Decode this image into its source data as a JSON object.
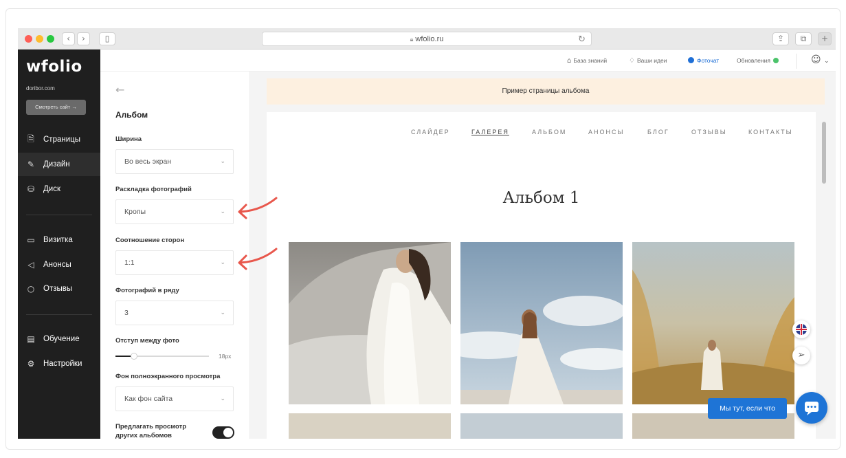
{
  "browser": {
    "url": "wfolio.ru"
  },
  "sidebar": {
    "logo": "wfolio",
    "site": "doribor.com",
    "view_site": "Смотреть сайт →",
    "items": [
      {
        "label": "Страницы",
        "icon": "page-icon"
      },
      {
        "label": "Дизайн",
        "icon": "brush-icon"
      },
      {
        "label": "Диск",
        "icon": "disk-icon"
      },
      {
        "label": "Визитка",
        "icon": "card-icon"
      },
      {
        "label": "Анонсы",
        "icon": "megaphone-icon"
      },
      {
        "label": "Отзывы",
        "icon": "reviews-icon"
      },
      {
        "label": "Обучение",
        "icon": "book-icon"
      },
      {
        "label": "Настройки",
        "icon": "gear-icon"
      }
    ]
  },
  "topbar": {
    "knowledge": "База знаний",
    "ideas": "Ваши идеи",
    "photochat": "Фоточат",
    "updates": "Обновления"
  },
  "panel": {
    "title": "Альбом",
    "width_label": "Ширина",
    "width_value": "Во весь экран",
    "layout_label": "Раскладка фотографий",
    "layout_value": "Кропы",
    "ratio_label": "Соотношение сторон",
    "ratio_value": "1:1",
    "per_row_label": "Фотографий в ряду",
    "per_row_value": "3",
    "gap_label": "Отступ между фото",
    "gap_value": "18px",
    "gap_fraction": 0.2,
    "bg_label": "Фон полноэкранного просмотра",
    "bg_value": "Как фон сайта",
    "suggest_label": "Предлагать просмотр других альбомов",
    "suggest_on": true
  },
  "preview": {
    "notice": "Пример страницы альбома",
    "menu": [
      "СЛАЙДЕР",
      "ГАЛЕРЕЯ",
      "АЛЬБОМ",
      "АНОНСЫ",
      "БЛОГ",
      "ОТЗЫВЫ",
      "КОНТАКТЫ"
    ],
    "active_menu": "ГАЛЕРЕЯ",
    "album_title": "Альбом 1"
  },
  "chat": {
    "bubble": "Мы тут, если что"
  },
  "colors": {
    "accent": "#1e74d6",
    "sidebar": "#1f1f1f",
    "notice": "#fdf0e0",
    "arrow": "#e8574c"
  }
}
